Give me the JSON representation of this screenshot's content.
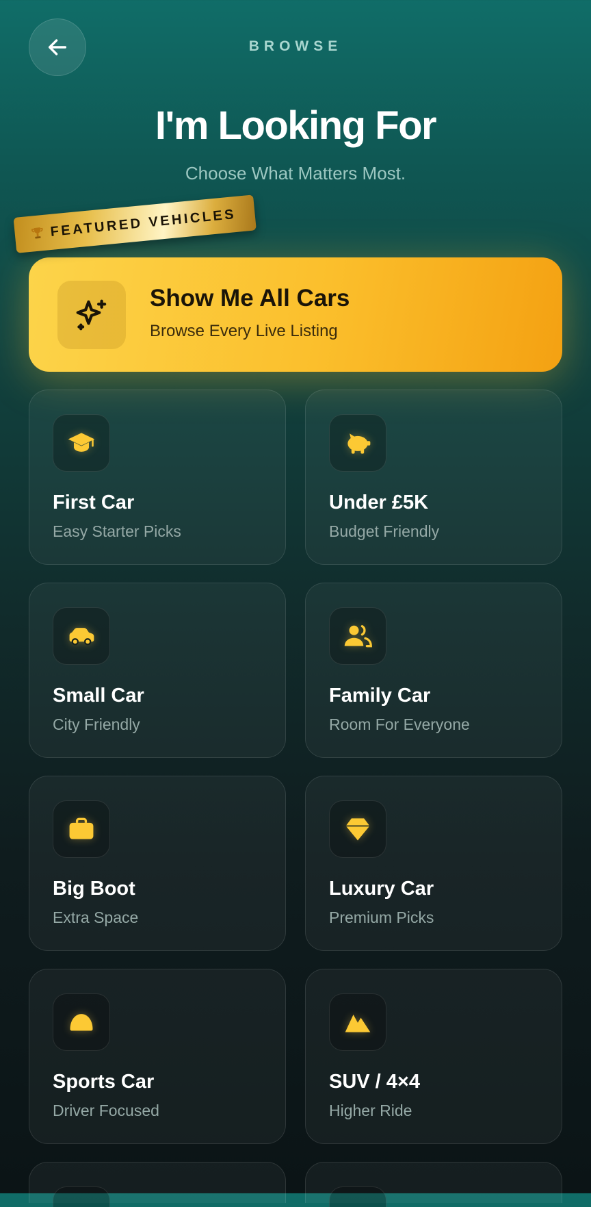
{
  "header": {
    "label": "BROWSE",
    "back_icon": "arrow-left-icon"
  },
  "hero": {
    "title": "I'm Looking For",
    "subtitle": "Choose What Matters Most."
  },
  "featured": {
    "ribbon_label": "FEATURED VEHICLES",
    "ribbon_icon": "trophy-icon",
    "title": "Show Me All Cars",
    "subtitle": "Browse Every Live Listing",
    "icon": "sparkles-icon"
  },
  "categories": [
    {
      "title": "First Car",
      "subtitle": "Easy Starter Picks",
      "icon": "graduation-cap-icon"
    },
    {
      "title": "Under £5K",
      "subtitle": "Budget Friendly",
      "icon": "piggy-bank-icon"
    },
    {
      "title": "Small Car",
      "subtitle": "City Friendly",
      "icon": "small-car-icon"
    },
    {
      "title": "Family Car",
      "subtitle": "Room For Everyone",
      "icon": "users-icon"
    },
    {
      "title": "Big Boot",
      "subtitle": "Extra Space",
      "icon": "suitcase-icon"
    },
    {
      "title": "Luxury Car",
      "subtitle": "Premium Picks",
      "icon": "diamond-icon"
    },
    {
      "title": "Sports Car",
      "subtitle": "Driver Focused",
      "icon": "helmet-icon"
    },
    {
      "title": "SUV / 4×4",
      "subtitle": "Higher Ride",
      "icon": "mountain-icon"
    }
  ],
  "colors": {
    "accent": "#fcc934",
    "background_top": "#106d68",
    "background_bottom": "#0b1416"
  }
}
